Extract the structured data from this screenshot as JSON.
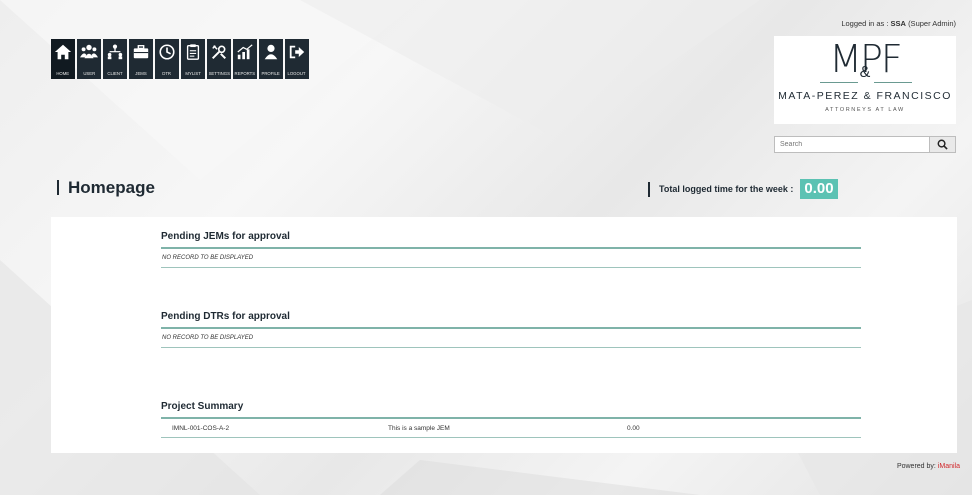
{
  "nav": {
    "items": [
      {
        "label": "HOME",
        "icon": "home-icon"
      },
      {
        "label": "USER",
        "icon": "users-icon"
      },
      {
        "label": "CLIENT",
        "icon": "org-chart-icon"
      },
      {
        "label": "JEMS",
        "icon": "briefcase-icon"
      },
      {
        "label": "DTR",
        "icon": "clock-icon"
      },
      {
        "label": "MYLIST",
        "icon": "clipboard-icon"
      },
      {
        "label": "SETTINGS",
        "icon": "tools-icon"
      },
      {
        "label": "REPORTS",
        "icon": "bar-chart-icon"
      },
      {
        "label": "PROFILE",
        "icon": "user-icon"
      },
      {
        "label": "LOGOUT",
        "icon": "logout-icon"
      }
    ],
    "active": "HOME"
  },
  "header": {
    "logged_prefix": "Logged in as :",
    "logged_user": "SSA",
    "logged_role": "(Super Admin)"
  },
  "logo": {
    "monogram": "MPF",
    "ampersand": "&",
    "name": "MATA-PEREZ & FRANCISCO",
    "subtitle": "ATTORNEYS AT LAW"
  },
  "search": {
    "placeholder": "Search"
  },
  "page": {
    "title": "Homepage",
    "logged_time_label": "Total logged time for the week :",
    "logged_time_value": "0.00"
  },
  "sections": {
    "pending_jems": {
      "title": "Pending JEMs for approval",
      "empty_text": "NO RECORD TO BE DISPLAYED"
    },
    "pending_dtrs": {
      "title": "Pending DTRs for approval",
      "empty_text": "NO RECORD TO BE DISPLAYED"
    },
    "project_summary": {
      "title": "Project Summary",
      "rows": [
        {
          "code": "IMNL-001-COS-A-2",
          "description": "This is a sample JEM",
          "hours": "0.00"
        }
      ]
    }
  },
  "footer": {
    "powered_prefix": "Powered by:",
    "powered_brand": "iManila"
  },
  "colors": {
    "nav_bg": "#1f2a33",
    "accent": "#5cc2b3",
    "rule": "#7fb3a9",
    "brand_red": "#d1272b"
  }
}
